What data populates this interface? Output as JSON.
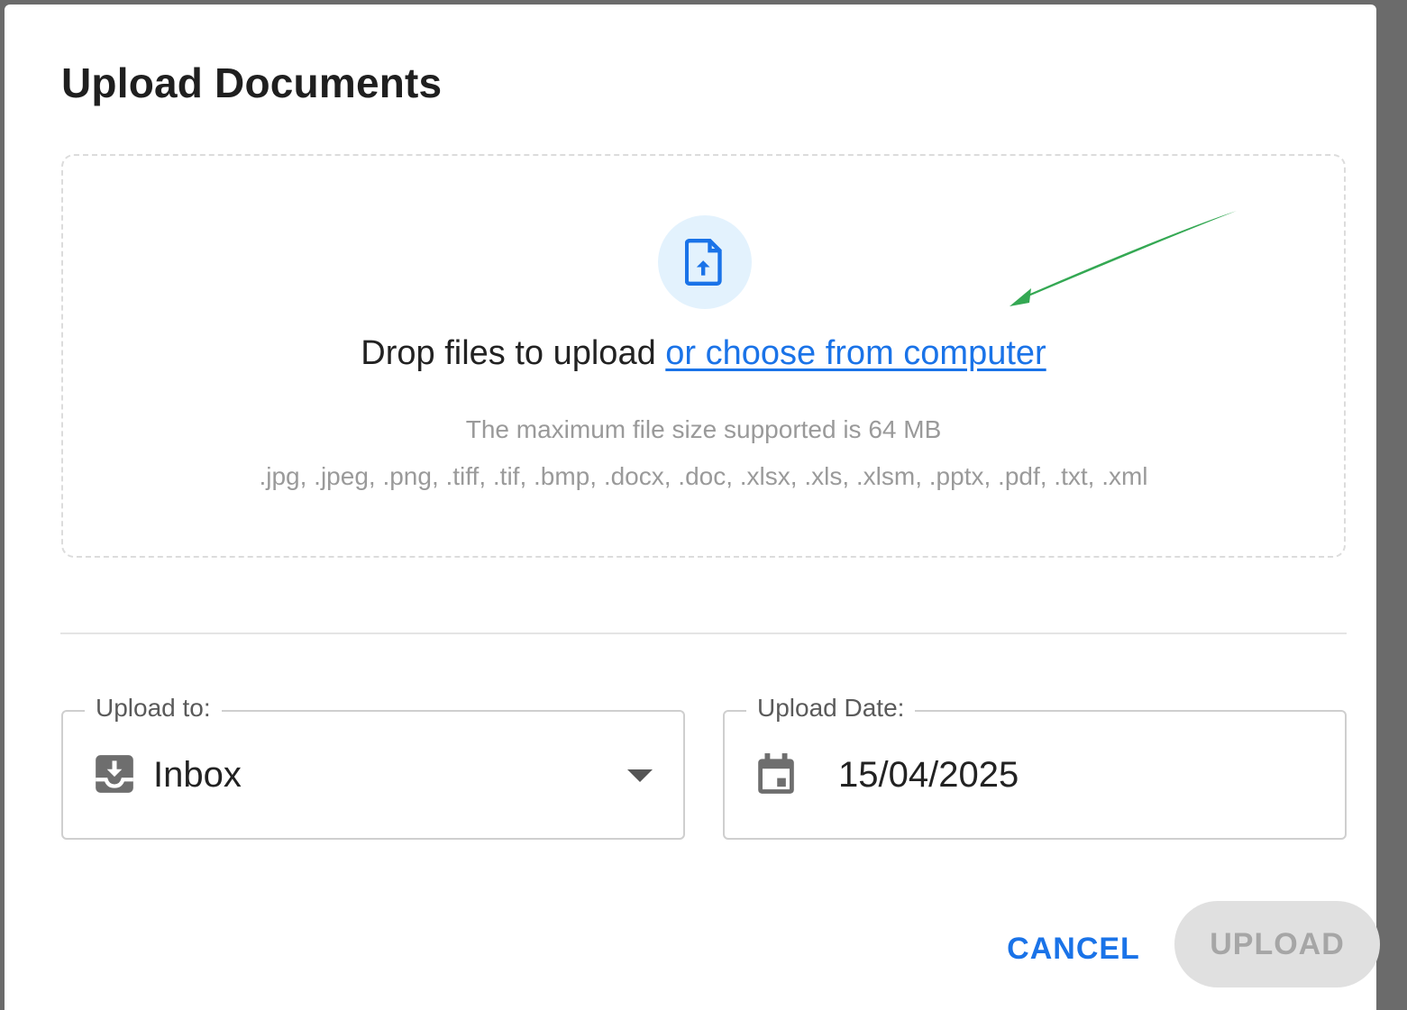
{
  "dialog": {
    "title": "Upload Documents"
  },
  "dropzone": {
    "icon": "file-upload-icon",
    "drop_text": "Drop files to upload ",
    "choose_link": "or choose from computer",
    "max_size_text": "The maximum file size supported is 64 MB",
    "file_types_text": ".jpg, .jpeg, .png, .tiff, .tif, .bmp, .docx, .doc, .xlsx, .xls, .xlsm, .pptx, .pdf, .txt, .xml"
  },
  "upload_to": {
    "label": "Upload to:",
    "icon": "inbox-icon",
    "value": "Inbox"
  },
  "upload_date": {
    "label": "Upload Date:",
    "icon": "calendar-icon",
    "value": "15/04/2025"
  },
  "actions": {
    "cancel_label": "CANCEL",
    "upload_label": "UPLOAD",
    "upload_enabled": false
  },
  "colors": {
    "accent": "#1a73e8",
    "icon_circle_bg": "#e3f2fd",
    "annotation_arrow": "#34a853"
  }
}
